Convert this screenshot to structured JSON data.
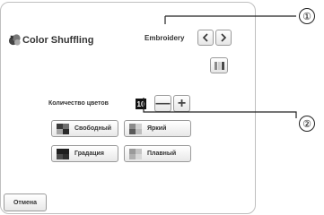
{
  "dialog": {
    "title": "Color Shuffling",
    "mode_label": "Embroidery",
    "count_label": "Количество цветов",
    "count_value": "10",
    "minus_label": "—",
    "plus_label": "+",
    "style_buttons": [
      {
        "label": "Свободный",
        "swatch": [
          "#3a3a3a",
          "#6f6f6f",
          "#a5a5a5",
          "#2a2a2a"
        ]
      },
      {
        "label": "Яркий",
        "swatch": [
          "#8a8a8a",
          "#d0d0d0",
          "#5a5a5a",
          "#bdbdbd"
        ]
      },
      {
        "label": "Градация",
        "swatch": [
          "#1e1e1e",
          "#1e1e1e",
          "#4a4a4a",
          "#2e2e2e"
        ]
      },
      {
        "label": "Плавный",
        "swatch": [
          "#9a9a9a",
          "#c4c4c4",
          "#b0b0b0",
          "#d8d8d8"
        ]
      }
    ],
    "palette_colors": [
      "#8a8a8a",
      "#cfcfcf",
      "#4a4a4a"
    ],
    "cancel_label": "Отмена"
  },
  "callouts": [
    {
      "label": "①"
    },
    {
      "label": "②"
    }
  ],
  "colors": {
    "border": "#bfbfbf",
    "button_border": "#9a9a9a",
    "count_bg": "#111111"
  }
}
